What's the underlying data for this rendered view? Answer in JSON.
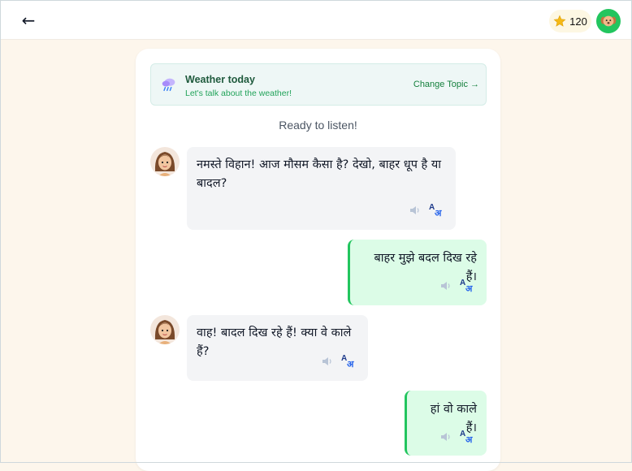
{
  "header": {
    "back_icon": "arrow-left-icon",
    "points": "120",
    "points_icon": "star-icon",
    "avatar_icon": "dog-avatar-icon"
  },
  "topic": {
    "icon": "rain-cloud-icon",
    "title": "Weather today",
    "subtitle": "Let's talk about the weather!",
    "change_label": "Change Topic →"
  },
  "status": "Ready to listen!",
  "messages": [
    {
      "role": "tutor",
      "text": "नमस्ते विहान! आज मौसम कैसा है? देखो, बाहर धूप है या बादल?"
    },
    {
      "role": "user",
      "text": "बाहर मुझे बदल दिख रहे हैं।"
    },
    {
      "role": "tutor",
      "text": "वाह! बादल दिख रहे हैं! क्या वे काले हैं?"
    },
    {
      "role": "user",
      "text": "हां वो काले हैं।"
    }
  ],
  "actions": {
    "speak_icon": "speaker-icon",
    "translate_icon": "translate-icon",
    "translate_latin": "A",
    "translate_hindi": "अ"
  },
  "colors": {
    "accent": "#22c55e",
    "background": "#fdf6ec",
    "user_bubble": "#dcfce7",
    "tutor_bubble": "#f3f4f6",
    "topic_bg": "#eef7f6"
  }
}
